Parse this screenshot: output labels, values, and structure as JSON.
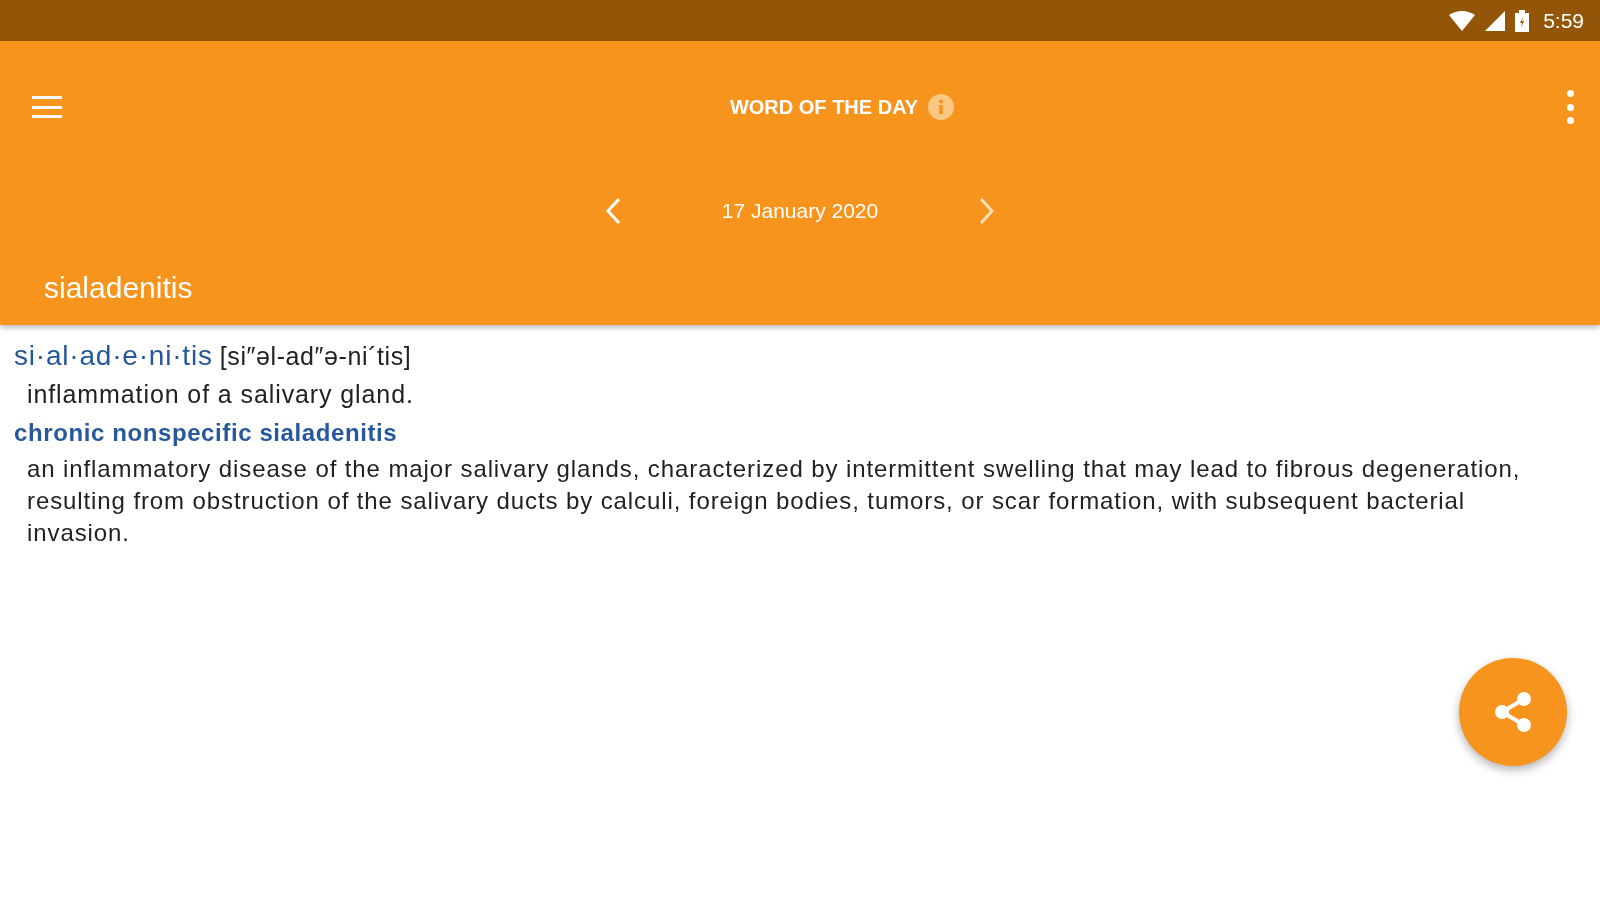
{
  "status_bar": {
    "time": "5:59"
  },
  "toolbar": {
    "title": "WORD OF THE DAY"
  },
  "date_nav": {
    "date": "17 January 2020"
  },
  "word": "sialadenitis",
  "entry": {
    "headword": "si·al·ad·e·ni·tis",
    "pronunciation": "[si″əl-ad″ə-ni´tis]",
    "definition": "inflammation of a salivary gland."
  },
  "subentries": [
    {
      "term": "chronic nonspecific sialadenitis",
      "definition": "an inflammatory disease of the major salivary glands, characterized by intermittent swelling that may lead to fibrous degeneration, resulting from obstruction of the salivary ducts by calculi, foreign bodies, tumors, or scar formation, with subsequent bacterial invasion."
    }
  ]
}
